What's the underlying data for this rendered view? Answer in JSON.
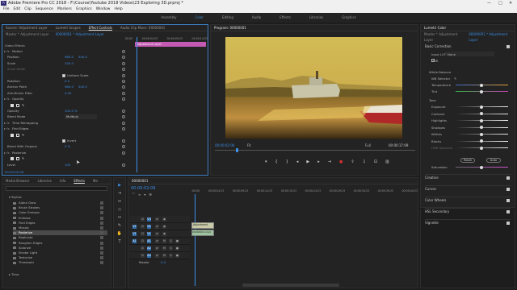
{
  "window": {
    "title": "Adobe Premiere Pro CC 2018 - F:\\Course\\Youtube 2018 Videos\\23 Exploring 3D.prproj *",
    "app_icon": "Pr",
    "controls": [
      "—",
      "□",
      "✕"
    ]
  },
  "menu": [
    "File",
    "Edit",
    "Clip",
    "Sequence",
    "Markers",
    "Graphics",
    "Window",
    "Help"
  ],
  "workspaces": [
    {
      "label": "Assembly",
      "active": false
    },
    {
      "label": "Color",
      "active": true
    },
    {
      "label": "Editing",
      "active": false
    },
    {
      "label": "Audio",
      "active": false
    },
    {
      "label": "Effects",
      "active": false
    },
    {
      "label": "Libraries",
      "active": false
    },
    {
      "label": "Graphics",
      "active": false
    }
  ],
  "effect_controls": {
    "tabs": [
      "Source: Adjustment Layer",
      "Lumetri Scopes",
      "Effect Controls",
      "Audio Clip Mixer: 00000001"
    ],
    "active_tab": "Effect Controls",
    "master_label": "Master * Adjustment Layer",
    "clip_label": "00000001 * Adjustment Layer",
    "times": [
      "00:00",
      "00:00:04:23",
      "00:00:09:23",
      "00:00:14:23"
    ],
    "clip_bar_label": "Adjustment Layer",
    "section": "Video Effects",
    "rows": [
      {
        "label": "Motion",
        "indent": 2,
        "fx": true
      },
      {
        "label": "Position",
        "indent": 6,
        "val": "960.0",
        "val2": "540.0"
      },
      {
        "label": "Scale",
        "indent": 6,
        "val": "100.0"
      },
      {
        "label": "Scale Width",
        "indent": 6,
        "val": "",
        "dim": true
      },
      {
        "label": "Uniform Scale",
        "indent": 80,
        "check": true
      },
      {
        "label": "Rotation",
        "indent": 6,
        "val": "0.0"
      },
      {
        "label": "Anchor Point",
        "indent": 6,
        "val": "960.0",
        "val2": "540.0"
      },
      {
        "label": "Anti-flicker Filter",
        "indent": 6,
        "val": "0.00"
      },
      {
        "label": "Opacity",
        "indent": 2,
        "fx": true
      },
      {
        "label": "",
        "indent": 6,
        "shapes": true
      },
      {
        "label": "Opacity",
        "indent": 6,
        "val": "100.0 %"
      },
      {
        "label": "Blend Mode",
        "indent": 6,
        "val": "Multiply",
        "select": true
      },
      {
        "label": "Time Remapping",
        "indent": 2,
        "fx": true
      },
      {
        "label": "Find Edges",
        "indent": 2,
        "fx": true
      },
      {
        "label": "",
        "indent": 6,
        "shapes": true
      },
      {
        "label": "Invert",
        "indent": 80,
        "check": true
      },
      {
        "label": "Blend With Original",
        "indent": 6,
        "val": "0 %"
      },
      {
        "label": "Posterize",
        "indent": 2,
        "fx": true
      },
      {
        "label": "",
        "indent": 6,
        "shapes": true
      },
      {
        "label": "Level",
        "indent": 6,
        "val": "100"
      }
    ],
    "timecode": "00:00:02:06"
  },
  "program_monitor": {
    "title": "Program: 00000001",
    "timecode_in": "00:00:02:06",
    "fit": "Fit",
    "quality": "Full",
    "timecode_out": "00:00:17:09"
  },
  "lumetri": {
    "title": "Lumetri Color",
    "master_label": "Master * Adjustment Layer",
    "clip_label": "00000001 * Adjustment Layer",
    "basic_correction": "Basic Correction",
    "input_lut_label": "Input LUT",
    "input_lut": "None",
    "hdr_label": "HDR",
    "white_balance": "White Balance",
    "wb_selector": "WB Selector",
    "temperature": "Temperature",
    "tint": "Tint",
    "tone": "Tone",
    "tone_rows": [
      "Exposure",
      "Contrast",
      "Highlights",
      "Shadows",
      "Whites",
      "Blacks",
      "HDR Specular"
    ],
    "reset": "Reset",
    "auto": "Auto",
    "saturation": "Saturation",
    "sections": [
      "Creative",
      "Curves",
      "Color Wheels",
      "HSL Secondary",
      "Vignette"
    ]
  },
  "effects_panel": {
    "tabs": [
      "Media Browser",
      "Libraries",
      "Info",
      "Effects",
      "Ma"
    ],
    "active_tab": "Effects",
    "search_value": "",
    "tree_top": "Stylize",
    "items": [
      "Alpha Glow",
      "Brush Strokes",
      "Color Emboss",
      "Emboss",
      "Find Edges",
      "Mosaic",
      "Posterize",
      "Replicate",
      "Roughen Edges",
      "Solarize",
      "Strobe Light",
      "Texturize",
      "Threshold"
    ],
    "selected_item": "Posterize",
    "time_folder": "Time"
  },
  "timeline": {
    "tab": "00000001",
    "timecode": "00:00:02:06",
    "ruler": [
      ":00:00",
      "00:00:04:23",
      "00:00:09:23",
      "00:00:14:23",
      "00:00:19:23",
      "00:00:24:23",
      "00:00:29:23",
      "00:00:34:23",
      "00:00:39:23",
      "00:00:44:23"
    ],
    "tracks": [
      "V3",
      "V2",
      "V1",
      "A1",
      "A2",
      "A3"
    ],
    "master_label": "Master",
    "master_value": "0.0",
    "clip_label": "Adjustment",
    "clip2_label": "00000001.mp4"
  },
  "tools": [
    "selection-tool",
    "track-select-tool",
    "ripple-edit-tool",
    "razor-tool",
    "slip-tool",
    "pen-tool",
    "hand-tool",
    "type-tool"
  ],
  "tool_glyphs": [
    "▶",
    "⇥",
    "⇔",
    "◇",
    "↔",
    "✎",
    "✋",
    "T"
  ],
  "colors": {
    "accent_blue": "#3a8ee6",
    "clip_pink": "#c45ab3",
    "workspace_active": "#3d8fd6",
    "record_red": "#d03030"
  }
}
